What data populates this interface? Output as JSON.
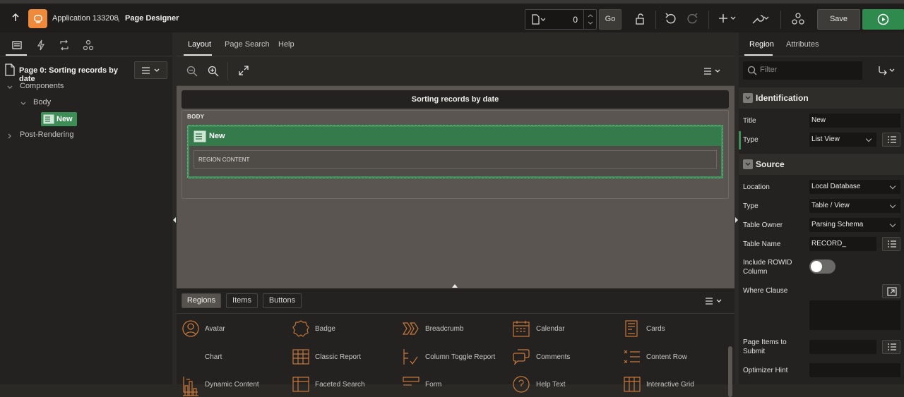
{
  "topbar": {
    "app_title": "Application 133208",
    "separator": "\\",
    "page_designer": "Page Designer",
    "page_number": "0",
    "go_label": "Go",
    "save_label": "Save"
  },
  "left_panel": {
    "page_label": "Page 0: Sorting records by date",
    "tree": {
      "components": "Components",
      "body": "Body",
      "region_new": "New",
      "post_rendering": "Post-Rendering"
    }
  },
  "center": {
    "tabs": [
      "Layout",
      "Page Search",
      "Help"
    ],
    "page_header": "Sorting records by date",
    "body_label": "BODY",
    "region_title": "New",
    "region_content": "REGION CONTENT"
  },
  "gallery": {
    "tabs": [
      "Regions",
      "Items",
      "Buttons"
    ],
    "items": [
      [
        "Avatar",
        "Badge",
        "Breadcrumb",
        "Calendar",
        "Cards"
      ],
      [
        "Chart",
        "Classic Report",
        "Column Toggle Report",
        "Comments",
        "Content Row"
      ],
      [
        "Dynamic Content",
        "Faceted Search",
        "Form",
        "Help Text",
        "Interactive Grid"
      ]
    ]
  },
  "right_panel": {
    "tabs": [
      "Region",
      "Attributes"
    ],
    "filter_placeholder": "Filter",
    "identification": {
      "header": "Identification",
      "title_label": "Title",
      "title_value": "New",
      "type_label": "Type",
      "type_value": "List View"
    },
    "source": {
      "header": "Source",
      "location_label": "Location",
      "location_value": "Local Database",
      "type_label": "Type",
      "type_value": "Table / View",
      "table_owner_label": "Table Owner",
      "table_owner_value": "Parsing Schema",
      "table_name_label": "Table Name",
      "table_name_value": "RECORD_",
      "rowid_label_1": "Include ROWID",
      "rowid_label_2": "Column",
      "where_label": "Where Clause",
      "page_items_label_1": "Page Items to",
      "page_items_label_2": "Submit",
      "optimizer_label": "Optimizer Hint"
    }
  },
  "colors": {
    "accent_green": "#2f8a4e",
    "region_green": "#3f8f5a",
    "logo_orange": "#f08a3a",
    "gallery_icon_orange": "#c8773a"
  }
}
